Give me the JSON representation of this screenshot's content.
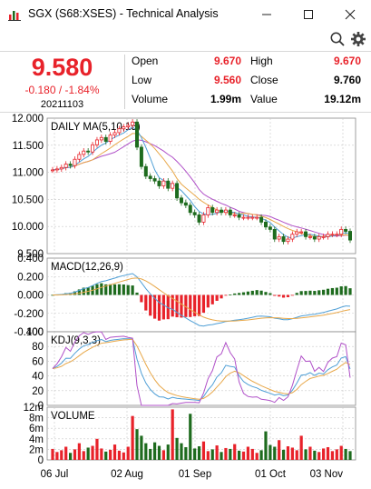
{
  "window": {
    "title": "SGX (S68:XSES) - Technical Analysis",
    "minimize": "—",
    "maximize": "☐",
    "close": "✕"
  },
  "toolbar": {
    "search_icon": "search-icon",
    "settings_icon": "gear-icon"
  },
  "quote": {
    "price": "9.580",
    "change": "-0.180 / -1.84%",
    "date": "20211103",
    "open_label": "Open",
    "open": "9.670",
    "high_label": "High",
    "high": "9.670",
    "low_label": "Low",
    "low": "9.560",
    "close_label": "Close",
    "close": "9.760",
    "volume_label": "Volume",
    "volume": "1.99m",
    "value_label": "Value",
    "value": "19.12m"
  },
  "colors": {
    "up": "#e8222a",
    "down": "#1e6b1e",
    "ma5": "#4f9fd6",
    "ma10": "#e8a84a",
    "ma15": "#b050c8"
  },
  "chart_data": [
    {
      "type": "line",
      "title": "DAILY MA(5,10,15)",
      "ylim": [
        9.3,
        12.1
      ],
      "yticks": [
        "12.000",
        "11.500",
        "11.000",
        "10.500",
        "10.000",
        "9.500"
      ],
      "xticks": [
        "06 Jul",
        "02 Aug",
        "01 Sep",
        "01 Oct",
        "03 Nov"
      ],
      "series": [
        {
          "name": "Close",
          "values": [
            11.03,
            11.05,
            11.08,
            11.15,
            11.12,
            11.25,
            11.35,
            11.42,
            11.4,
            11.55,
            11.65,
            11.7,
            11.62,
            11.75,
            11.8,
            11.88,
            11.92,
            11.95,
            12.02,
            11.5,
            11.1,
            10.9,
            10.85,
            10.8,
            10.7,
            10.8,
            10.65,
            10.75,
            10.45,
            10.35,
            10.3,
            10.15,
            10.1,
            9.95,
            10.1,
            10.25,
            10.15,
            10.2,
            10.15,
            10.2,
            10.1,
            10.1,
            10.05,
            10.05,
            10.05,
            10.05,
            10.05,
            9.95,
            9.85,
            9.8,
            9.6,
            9.65,
            9.55,
            9.6,
            9.7,
            9.75,
            9.75,
            9.65,
            9.65,
            9.6,
            9.65,
            9.65,
            9.7,
            9.7,
            9.7,
            9.8,
            9.76,
            9.58
          ]
        }
      ]
    },
    {
      "type": "bar",
      "title": "MACD(12,26,9)",
      "ylim": [
        -0.4,
        0.4
      ],
      "yticks": [
        "0.400",
        "0.200",
        "0.000",
        "-0.200",
        "-0.400"
      ]
    },
    {
      "type": "line",
      "title": "KDJ(9,3,3)",
      "ylim": [
        0,
        100
      ],
      "yticks": [
        "100",
        "80",
        "60",
        "40",
        "20",
        "0"
      ]
    },
    {
      "type": "bar",
      "title": "VOLUME",
      "ylim": [
        0,
        12
      ],
      "yticks": [
        "12m",
        "8m",
        "6m",
        "4m",
        "2m",
        "0"
      ],
      "values": [
        2.5,
        1.8,
        2.2,
        3.0,
        1.6,
        2.4,
        3.8,
        2.0,
        2.8,
        3.2,
        4.8,
        2.6,
        1.9,
        2.3,
        3.5,
        2.1,
        1.7,
        3.0,
        10.0,
        7.0,
        5.5,
        3.8,
        2.5,
        4.0,
        3.2,
        2.2,
        3.5,
        11.5,
        5.0,
        3.8,
        2.9,
        10.5,
        2.6,
        3.1,
        4.2,
        2.0,
        2.4,
        3.3,
        1.8,
        2.7,
        2.5,
        3.6,
        2.1,
        1.9,
        3.0,
        2.5,
        1.6,
        2.2,
        6.5,
        3.4,
        3.0,
        4.5,
        2.3,
        3.1,
        2.8,
        2.2,
        5.5,
        2.4,
        3.0,
        2.1,
        1.8,
        2.6,
        2.9,
        2.0,
        2.4,
        3.2,
        2.5,
        2.0
      ]
    }
  ]
}
